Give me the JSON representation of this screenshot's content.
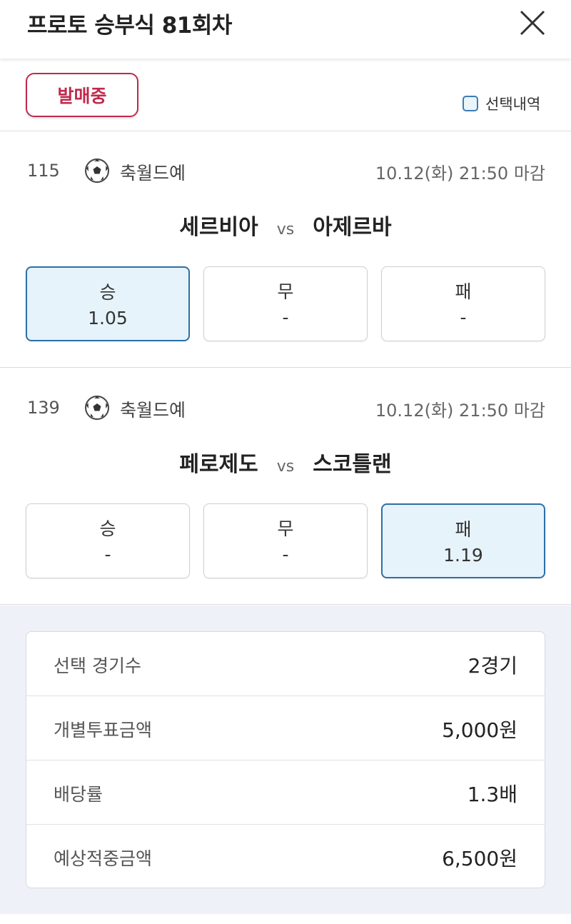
{
  "header": {
    "title": "프로토 승부식 81회차",
    "close_icon": "close-icon"
  },
  "status": {
    "badge_label": "발매중",
    "selection_label": "선택내역",
    "accent_color": "#c0294c"
  },
  "matches": [
    {
      "number": "115",
      "sport_icon": "soccer-ball-icon",
      "league": "축월드예",
      "deadline": "10.12(화) 21:50 마감",
      "home": "세르비아",
      "vs": "vs",
      "away": "아제르바",
      "odds": [
        {
          "label": "승",
          "value": "1.05",
          "selected": true
        },
        {
          "label": "무",
          "value": "-",
          "selected": false
        },
        {
          "label": "패",
          "value": "-",
          "selected": false
        }
      ]
    },
    {
      "number": "139",
      "sport_icon": "soccer-ball-icon",
      "league": "축월드예",
      "deadline": "10.12(화) 21:50 마감",
      "home": "페로제도",
      "vs": "vs",
      "away": "스코틀랜",
      "odds": [
        {
          "label": "승",
          "value": "-",
          "selected": false
        },
        {
          "label": "무",
          "value": "-",
          "selected": false
        },
        {
          "label": "패",
          "value": "1.19",
          "selected": true
        }
      ]
    }
  ],
  "summary": [
    {
      "label": "선택 경기수",
      "value": "2경기"
    },
    {
      "label": "개별투표금액",
      "value": "5,000원"
    },
    {
      "label": "배당률",
      "value": "1.3배"
    },
    {
      "label": "예상적중금액",
      "value": "6,500원"
    }
  ]
}
